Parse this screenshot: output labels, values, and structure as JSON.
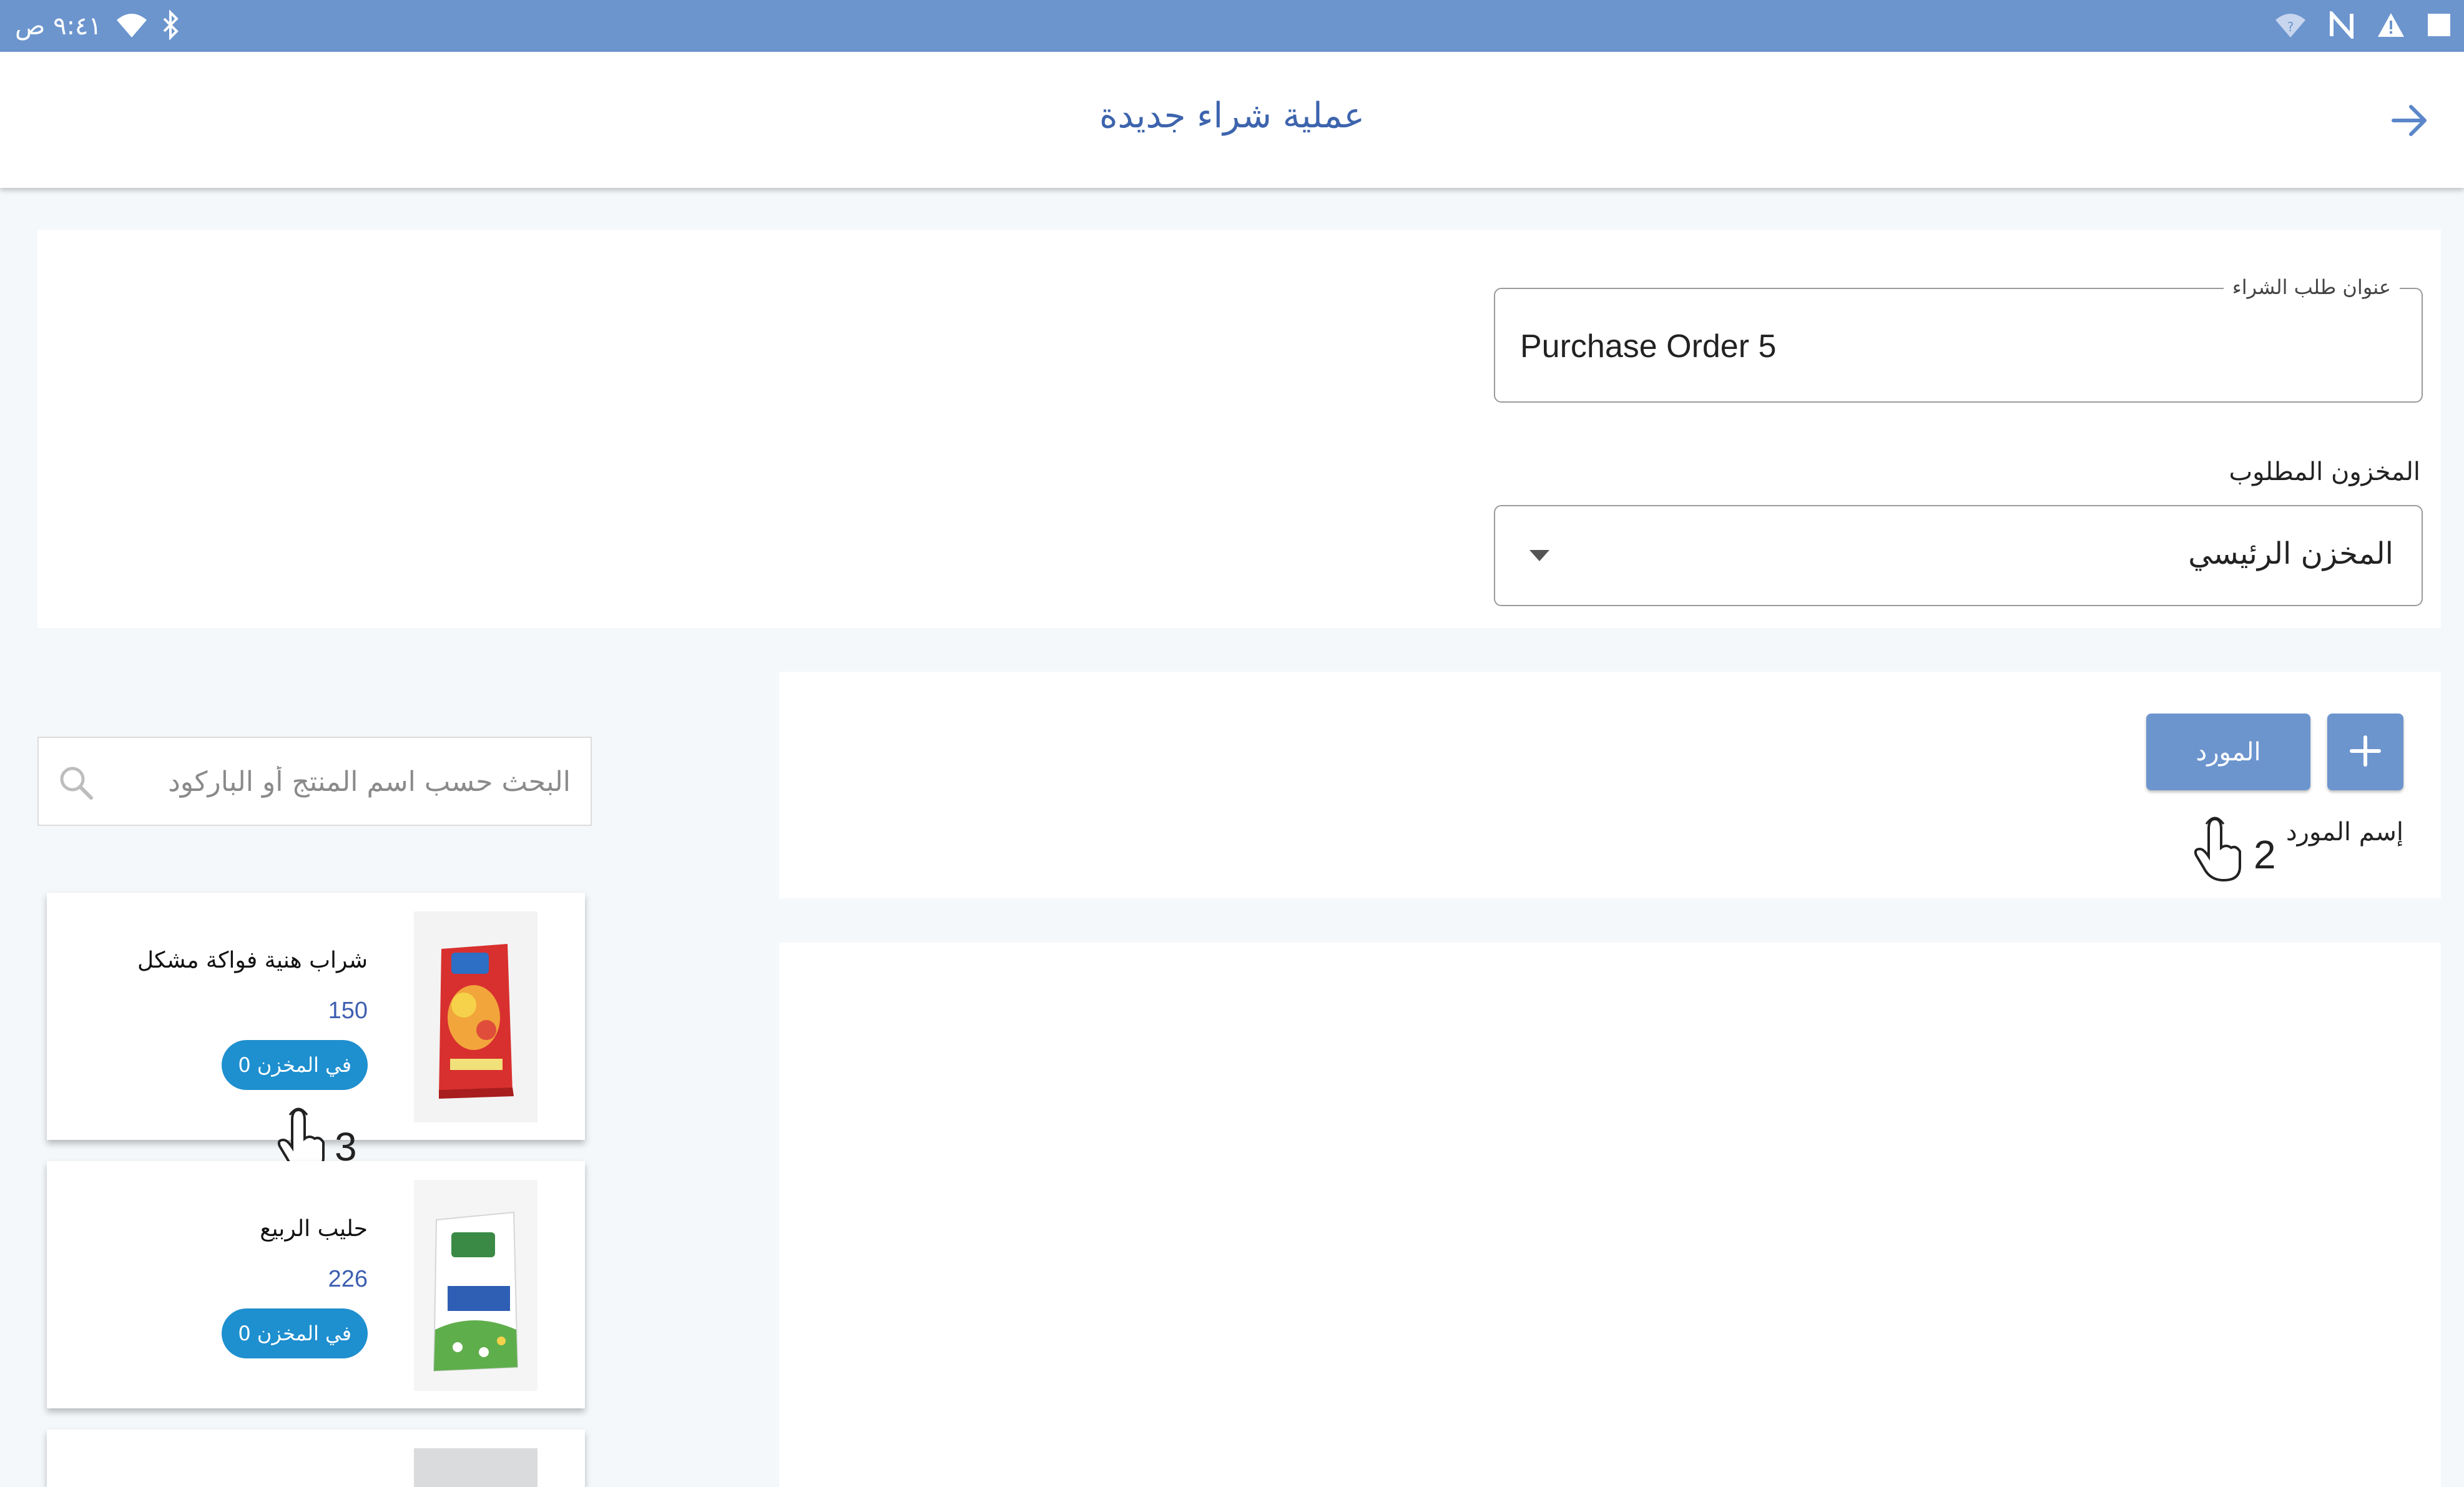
{
  "status_bar": {
    "time": "٩:٤١ ص"
  },
  "app_bar": {
    "title": "عملية شراء جديدة"
  },
  "form": {
    "order_title_label": "عنوان طلب الشراء",
    "order_title_value": "Purchase Order 5",
    "warehouse_label": "المخزون المطلوب",
    "warehouse_value": "المخزن الرئيسي"
  },
  "supplier": {
    "button_label": "المورد",
    "name_label": "إسم المورد"
  },
  "search": {
    "placeholder": "البحث حسب اسم المنتج أو الباركود"
  },
  "products": [
    {
      "name": "شراب هنية فواكة مشكل",
      "price": "150",
      "stock_label": "0 في المخزن"
    },
    {
      "name": "حليب الربيع",
      "price": "226",
      "stock_label": "0 في المخزن"
    }
  ],
  "tutorial_steps": {
    "step2": "2",
    "step3": "3"
  },
  "colors": {
    "status_bar": "#6c95ce",
    "title": "#3d64ad",
    "button": "#6c95ce",
    "stock_badge": "#1e8fcf",
    "price": "#3d5fb0"
  }
}
